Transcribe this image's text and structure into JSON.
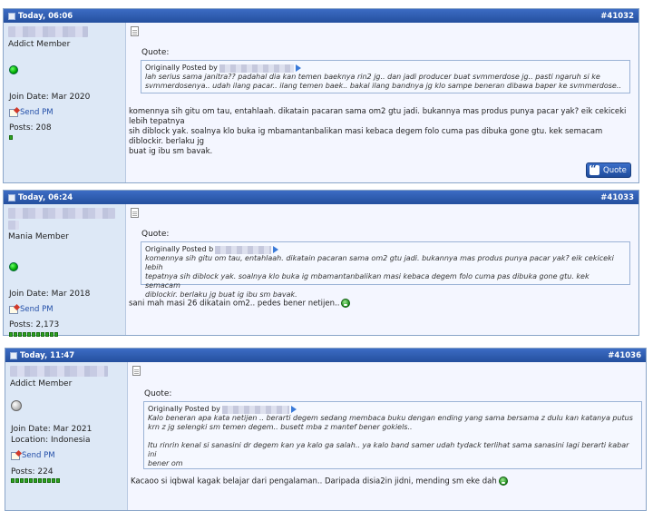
{
  "posts": [
    {
      "date": "Today, 06:06",
      "post_id": "#41032",
      "rank": "Addict Member",
      "status": "online",
      "join": "Join Date: Mar 2020",
      "location": "",
      "send_pm": "Send PM",
      "posts_count": "Posts: 208",
      "rep_dots": 1,
      "quote_label": "Quote:",
      "quote_by": "Originally Posted by",
      "quote_lines": [
        "lah serius sama janitra?? padahal dia kan temen baeknya rin2 jg.. dan jadi producer buat svmmerdose jg.. pasti ngaruh si ke",
        "svmmerdosenya.. udah ilang pacar.. ilang temen baek.. bakal ilang bandnya jg klo sampe beneran dibawa baper ke svmmerdose.."
      ],
      "reply_lines": [
        "komennya sih gitu om tau, entahlaah. dikatain pacaran sama om2 gtu jadi. bukannya mas produs punya pacar yak? eik cekiceki lebih tepatnya",
        "sih diblock yak. soalnya klo buka ig mbamantanbalikan masi kebaca degem folo cuma pas dibuka gone gtu. kek semacam diblockir. berlaku jg",
        "buat ig ibu sm bavak."
      ],
      "quote_button": "Quote",
      "smiley": false
    },
    {
      "date": "Today, 06:24",
      "post_id": "#41033",
      "rank": "Mania Member",
      "status": "online",
      "join": "Join Date: Mar 2018",
      "location": "",
      "send_pm": "Send PM",
      "posts_count": "Posts: 2,173",
      "rep_dots": 11,
      "quote_label": "Quote:",
      "quote_by": "Originally Posted b",
      "quote_lines": [
        "komennya sih gitu om tau, entahlaah. dikatain pacaran sama om2 gtu jadi. bukannya mas produs punya pacar yak? eik cekiceki lebih",
        "tepatnya sih diblock yak. soalnya klo buka ig mbamantanbalikan masi kebaca degem folo cuma pas dibuka gone gtu. kek semacam",
        "diblockir. berlaku jg buat ig ibu sm bavak."
      ],
      "reply_lines": [
        "sani mah masi 26 dikatain om2.. pedes bener netijen.."
      ],
      "quote_button": "",
      "smiley": true
    },
    {
      "date": "Today, 11:47",
      "post_id": "#41036",
      "rank": "Addict Member",
      "status": "offline",
      "join": "Join Date: Mar 2021",
      "location": "Location: Indonesia",
      "send_pm": "Send PM",
      "posts_count": "Posts: 224",
      "rep_dots": 11,
      "quote_label": "Quote:",
      "quote_by": "Originally Posted by",
      "quote_lines": [
        "Kalo beneran apa kata netijen .. berarti degem sedang membaca buku dengan ending yang sama bersama z dulu kan katanya putus",
        "krn z jg selengki sm temen degem.. busett mba z mantef bener gokiels..",
        "",
        "Itu rinrin kenal si sanasini dr degem kan ya kalo ga salah.. ya kalo band samer udah tydack terlihat sama sanasini lagi berarti kabar ini",
        "bener om"
      ],
      "reply_lines": [
        "Kacaoo si iqbwal kagak belajar dari pengalaman.. Daripada disia2in jidni, mending sm eke dah"
      ],
      "quote_button": "",
      "smiley": true
    }
  ]
}
